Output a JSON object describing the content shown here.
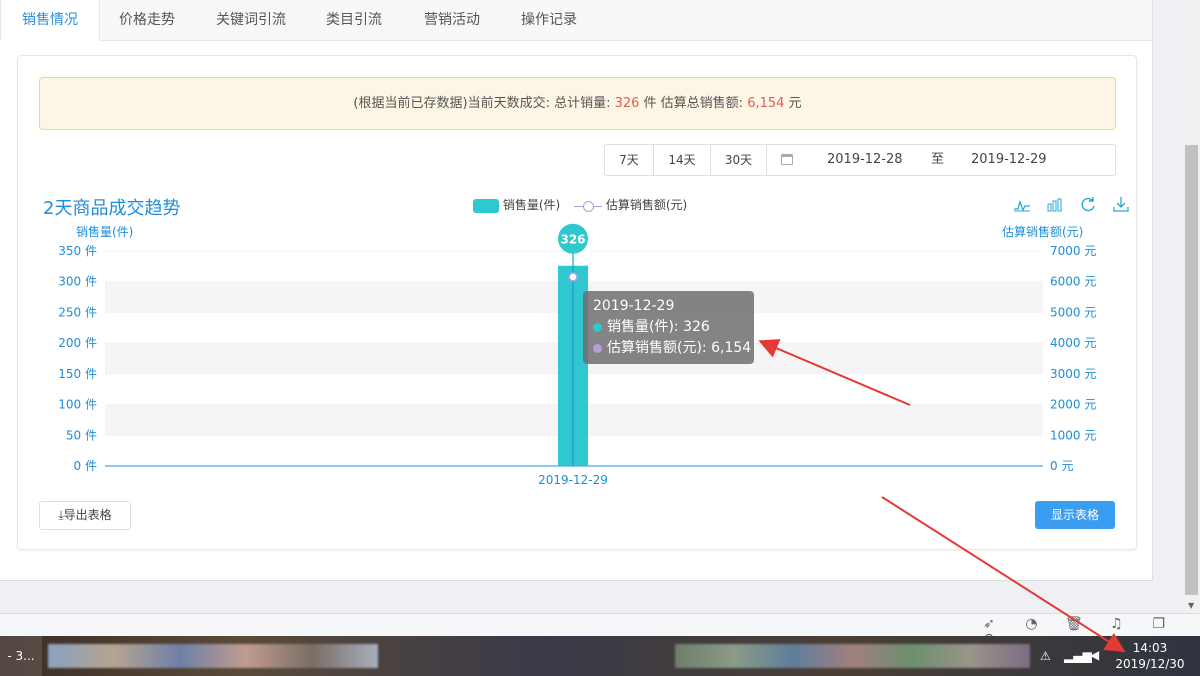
{
  "tabs": [
    {
      "label": "销售情况",
      "active": true
    },
    {
      "label": "价格走势"
    },
    {
      "label": "关键词引流"
    },
    {
      "label": "类目引流"
    },
    {
      "label": "营销活动"
    },
    {
      "label": "操作记录"
    }
  ],
  "notice": {
    "prefix": "(根据当前已存数据)当前天数成交: 总计销量: ",
    "qty": "326",
    "mid": " 件 估算总销售额: ",
    "amount": "6,154",
    "suffix": " 元"
  },
  "range": {
    "buttons": [
      "7天",
      "14天",
      "30天"
    ],
    "start": "2019-12-28",
    "sep": "至",
    "end": "2019-12-29"
  },
  "chart": {
    "title": "2天商品成交趋势",
    "legend_bar": "销售量(件)",
    "legend_line": "估算销售额(元)",
    "left_axis_name": "销售量(件)",
    "right_axis_name": "估算销售额(元)",
    "toolbox": [
      "line-chart-icon",
      "bar-chart-icon",
      "refresh-icon",
      "download-icon"
    ],
    "tooltip": {
      "date": "2019-12-29",
      "qty_label": "销售量(件): 326",
      "amount_label": "估算销售额(元): 6,154"
    },
    "bar_label": "326",
    "colors": {
      "bar": "#2fc8ce",
      "line": "#b39ddb",
      "axis": "#1f8ed6"
    }
  },
  "chart_data": {
    "type": "bar",
    "title": "2天商品成交趋势",
    "categories": [
      "2019-12-29"
    ],
    "series": [
      {
        "name": "销售量(件)",
        "values": [
          326
        ],
        "axis": "left"
      },
      {
        "name": "估算销售额(元)",
        "values": [
          6154
        ],
        "axis": "right",
        "type": "line"
      }
    ],
    "y_left": {
      "name": "销售量(件)",
      "min": 0,
      "max": 350,
      "ticks": [
        "0 件",
        "50 件",
        "100 件",
        "150 件",
        "200 件",
        "250 件",
        "300 件",
        "350 件"
      ]
    },
    "y_right": {
      "name": "估算销售额(元)",
      "min": 0,
      "max": 7000,
      "ticks": [
        "0 元",
        "1000 元",
        "2000 元",
        "3000 元",
        "4000 元",
        "5000 元",
        "6000 元",
        "7000 元"
      ]
    },
    "legend_position": "top-center"
  },
  "buttons": {
    "export": "⤓导出表格",
    "show_table": "显示表格"
  },
  "taskbar": {
    "app_label": "- 3...",
    "time": "14:03",
    "date": "2019/12/30"
  }
}
